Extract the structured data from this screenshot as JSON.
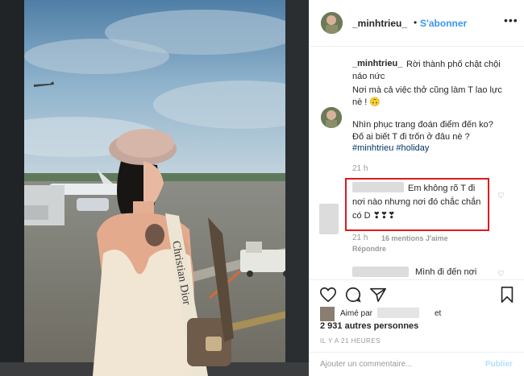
{
  "header": {
    "username": "_minhtrieu_",
    "dot": "•",
    "follow_label": "S'abonner",
    "more_label": "•••"
  },
  "caption": {
    "username": "_minhtrieu_",
    "line1": "Rời thành phố chật chội",
    "line2": "náo nức",
    "line3": "Nơi mà cả việc thở cũng làm T lao lực",
    "line4": "nè ! 🙃",
    "line5": "Nhìn phục trang đoán điểm đến ko?",
    "line6": "Đố ai biết T đi trốn ở đâu nè ?",
    "hashtags": "#minhtrieu #holiday",
    "time": "21 h"
  },
  "reply": {
    "line1": "Em không rõ T đi",
    "line2": "nơi nào nhưng nơi đó chắc chắn",
    "line3": "có D ❣❣❣",
    "time": "21 h",
    "likes": "16 mentions J'aime",
    "reply_label": "Répondre"
  },
  "reply2": {
    "text": "Mình đi đến nơi"
  },
  "likes": {
    "liked_by": "Aimé par",
    "and": "et",
    "count": "2 931 autres personnes"
  },
  "posted": "IL Y A 21 HEURES",
  "comment_box": {
    "placeholder": "Ajouter un commentaire...",
    "publish_label": "Publier"
  },
  "photo": {
    "bag_text": "Christian Dior"
  },
  "colors": {
    "link_blue": "#3897f0",
    "hashtag": "#003569",
    "highlight_red": "#e0191d"
  }
}
